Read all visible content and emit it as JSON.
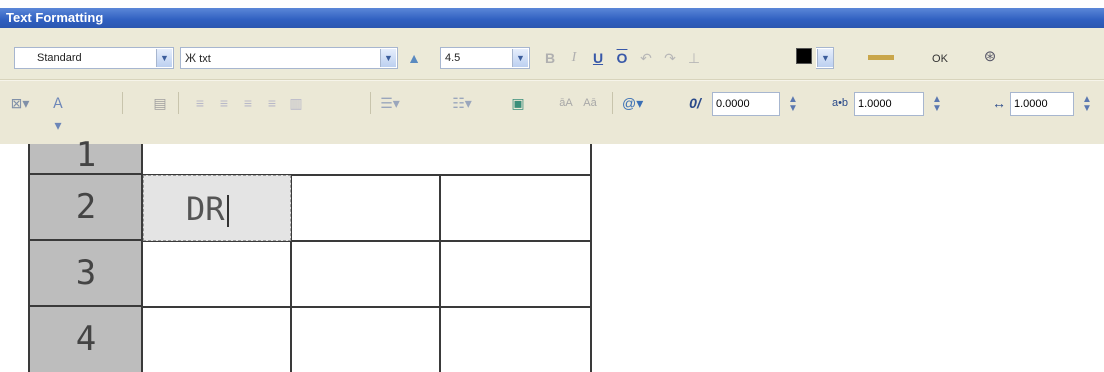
{
  "window": {
    "title": "Text Formatting"
  },
  "toolbar1": {
    "style_value": "Standard",
    "font_value": "txt",
    "height_value": "4.5",
    "ok_label": "OK",
    "color_value": "#000000"
  },
  "toolbar2": {
    "oblique_value": "0.0000",
    "tracking_value": "1.0000",
    "width_value": "1.0000"
  },
  "grid": {
    "rows": [
      "1",
      "2",
      "3",
      "4"
    ],
    "edit_text": "DR"
  },
  "icons": {
    "font_icon": "font-icon",
    "text_height_icon": "text-height-icon",
    "bold_icon": "bold-icon",
    "italic_icon": "italic-icon",
    "underline_icon": "underline-icon",
    "overline_icon": "overline-icon",
    "undo_icon": "undo-icon",
    "redo_icon": "redo-icon",
    "stack_icon": "stack-icon",
    "ruler_icon": "ruler-icon",
    "options_icon": "options-icon"
  },
  "colors": {
    "titlebar": "#2f5fc0",
    "toolbar": "#ecead8",
    "row_header": "#bdbdbd",
    "grid_line": "#3a3a3a"
  }
}
